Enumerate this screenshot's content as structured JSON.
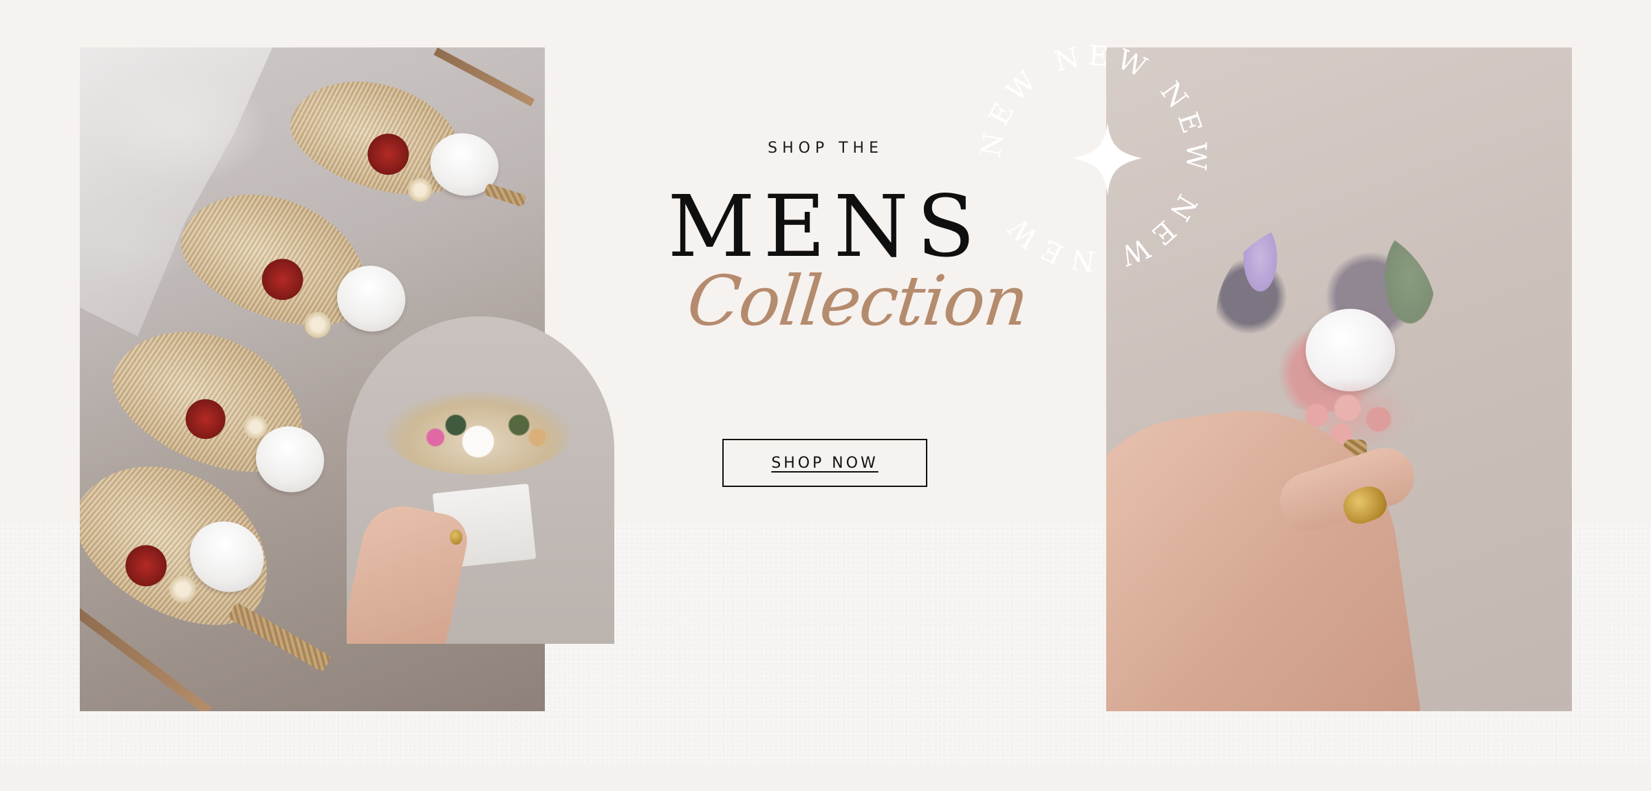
{
  "hero": {
    "eyebrow": "SHOP THE",
    "headline": "MENS",
    "script": "Collection",
    "cta_label": "SHOP NOW"
  },
  "badge": {
    "ring_text": "NEW NEW NEW NEW NEW",
    "icon": "sparkle-icon"
  },
  "images": {
    "left": "boutonnieres-in-box-photo",
    "arch": "boutonniere-in-hand-arch-photo",
    "right": "boutonniere-held-photo"
  },
  "colors": {
    "background": "#f6f2ef",
    "lower_band": "#f7f6f4",
    "headline": "#0f0f0f",
    "script_accent": "#b58b6e",
    "badge_text": "#ffffff"
  }
}
